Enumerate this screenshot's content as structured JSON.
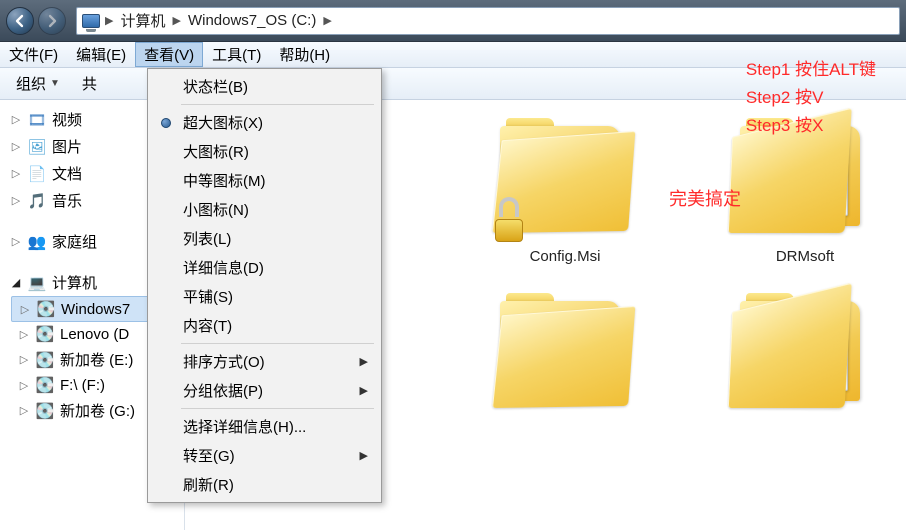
{
  "nav": {
    "back_label": "Back",
    "forward_label": "Forward"
  },
  "breadcrumb": {
    "items": [
      "计算机",
      "Windows7_OS (C:)"
    ]
  },
  "menubar": {
    "file": "文件(F)",
    "edit": "编辑(E)",
    "view": "查看(V)",
    "tools": "工具(T)",
    "help": "帮助(H)"
  },
  "toolbar": {
    "organize": "组织",
    "share": "共"
  },
  "sidebar": {
    "video": "视频",
    "pictures": "图片",
    "documents": "文档",
    "music": "音乐",
    "homegroup": "家庭组",
    "computer": "计算机",
    "drive_c": "Windows7",
    "drive_lenovo": "Lenovo (D",
    "drive_e": "新加卷 (E:)",
    "drive_f": "F:\\ (F:)",
    "drive_g": "新加卷 (G:)"
  },
  "view_menu": {
    "status_bar": "状态栏(B)",
    "extra_large": "超大图标(X)",
    "large": "大图标(R)",
    "medium": "中等图标(M)",
    "small": "小图标(N)",
    "list": "列表(L)",
    "details": "详细信息(D)",
    "tiles": "平铺(S)",
    "content": "内容(T)",
    "sort_by": "排序方式(O)",
    "group_by": "分组依据(P)",
    "choose_details": "选择详细信息(H)...",
    "go_to": "转至(G)",
    "refresh": "刷新(R)"
  },
  "folders": {
    "config_msi": "Config.Msi",
    "drmsoft": "DRMsoft"
  },
  "annotations": {
    "step1": "Step1  按住ALT键",
    "step2": "Step2  按V",
    "step3": "Step3  按X",
    "done": "完美搞定"
  }
}
